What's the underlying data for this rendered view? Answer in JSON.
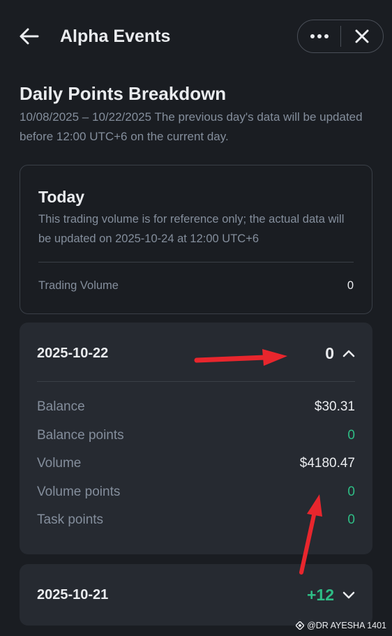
{
  "header": {
    "title": "Alpha Events",
    "icons": {
      "back": "arrow-left-icon",
      "more": "more-dots-icon",
      "close": "close-icon"
    }
  },
  "breakdown": {
    "title": "Daily Points Breakdown",
    "subtitle": "10/08/2025 – 10/22/2025 The previous day's data will be updated before 12:00 UTC+6 on the current day."
  },
  "today": {
    "title": "Today",
    "note": "This trading volume is for reference only; the actual data will be updated on 2025-10-24 at 12:00 UTC+6",
    "volume_label": "Trading Volume",
    "volume_value": "0"
  },
  "days": [
    {
      "date": "2025-10-22",
      "total": "0",
      "expanded": true,
      "rows": [
        {
          "label": "Balance",
          "value": "$30.31"
        },
        {
          "label": "Balance points",
          "value": "0"
        },
        {
          "label": "Volume",
          "value": "$4180.47"
        },
        {
          "label": "Volume points",
          "value": "0"
        },
        {
          "label": "Task points",
          "value": "0"
        }
      ]
    },
    {
      "date": "2025-10-21",
      "total": "+12",
      "expanded": false
    }
  ],
  "watermark": {
    "text": "@DR AYESHA 1401"
  },
  "colors": {
    "background": "#1a1d22",
    "card": "#262a31",
    "positive": "#2ebd85",
    "muted": "#848e9c",
    "annotation": "#e8262d"
  }
}
